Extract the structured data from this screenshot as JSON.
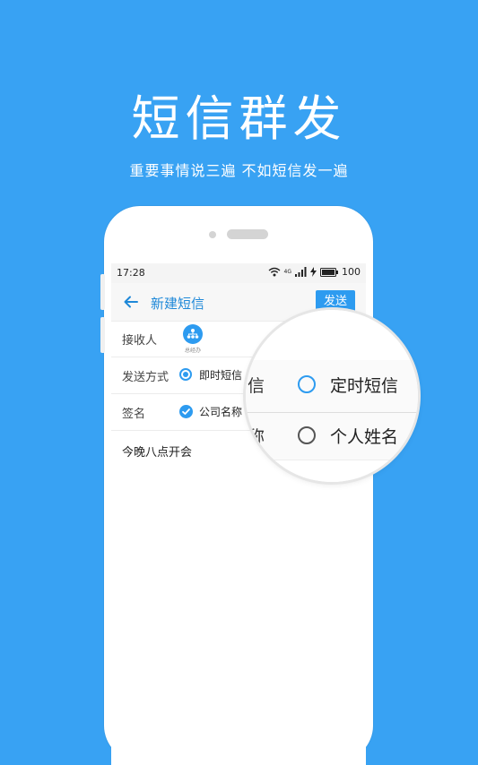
{
  "hero": {
    "title": "短信群发",
    "subtitle": "重要事情说三遍 不如短信发一遍"
  },
  "status_bar": {
    "time": "17:28",
    "network": "4G",
    "battery": "100"
  },
  "appbar": {
    "title": "新建短信",
    "send_label": "发送"
  },
  "form": {
    "recipient_label": "接收人",
    "recipient_chip": "总经办",
    "send_mode_label": "发送方式",
    "send_mode_selected": "即时短信",
    "signature_label": "签名",
    "signature_selected": "公司名称"
  },
  "message": "今晚八点开会",
  "magnifier": {
    "row1_fragment": "信",
    "row1_option": "定时短信",
    "row2_fragment": "称",
    "row2_option": "个人姓名"
  },
  "colors": {
    "background": "#38a2f3",
    "accent": "#2d9bf0",
    "title_blue": "#1e88d8"
  }
}
